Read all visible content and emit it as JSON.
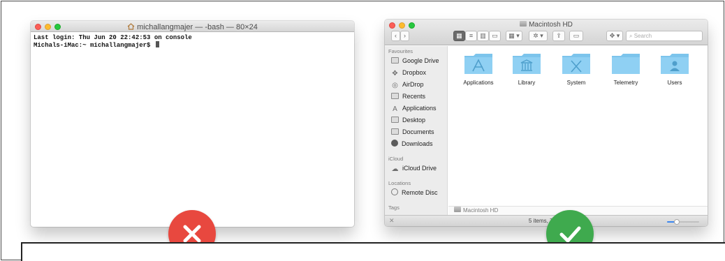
{
  "terminal": {
    "title": "michallangmajer — -bash — 80×24",
    "line1": "Last login: Thu Jun 20 22:42:53 on console",
    "prompt": "Michals-iMac:~ michallangmajer$ "
  },
  "finder": {
    "title": "Macintosh HD",
    "search_placeholder": "Search",
    "sidebar": {
      "favourites_header": "Favourites",
      "favourites": [
        {
          "label": "Google Drive",
          "icon": "folder-icon"
        },
        {
          "label": "Dropbox",
          "icon": "dropbox-icon"
        },
        {
          "label": "AirDrop",
          "icon": "airdrop-icon"
        },
        {
          "label": "Recents",
          "icon": "recents-icon"
        },
        {
          "label": "Applications",
          "icon": "applications-icon"
        },
        {
          "label": "Desktop",
          "icon": "desktop-icon"
        },
        {
          "label": "Documents",
          "icon": "documents-icon"
        },
        {
          "label": "Downloads",
          "icon": "downloads-icon"
        }
      ],
      "icloud_header": "iCloud",
      "icloud": [
        {
          "label": "iCloud Drive",
          "icon": "cloud-icon"
        }
      ],
      "locations_header": "Locations",
      "locations": [
        {
          "label": "Remote Disc",
          "icon": "disc-icon"
        }
      ],
      "tags_header": "Tags"
    },
    "items": [
      {
        "label": "Applications",
        "glyph": "A"
      },
      {
        "label": "Library",
        "glyph": "library"
      },
      {
        "label": "System",
        "glyph": "X"
      },
      {
        "label": "Telemetry",
        "glyph": ""
      },
      {
        "label": "Users",
        "glyph": "user"
      }
    ],
    "path_label": "Macintosh HD",
    "status_text": "5 items, 764,4",
    "icon_size_level": 0.3
  },
  "colors": {
    "folder": "#7cc4ec",
    "badge_wrong": "#e8483f",
    "badge_right": "#3faa4e"
  }
}
